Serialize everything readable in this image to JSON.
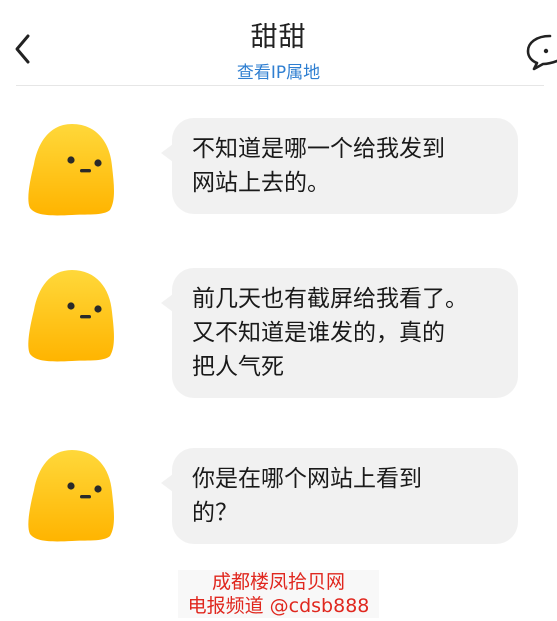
{
  "header": {
    "title": "甜甜",
    "subtitle": "查看IP属地",
    "back_icon": "chevron-left-icon",
    "right_icon": "chat-bubble-icon"
  },
  "messages": [
    {
      "sender": "甜甜",
      "text": "不知道是哪一个给我发到\n网站上去的。"
    },
    {
      "sender": "甜甜",
      "text": "前几天也有截屏给我看了。\n又不知道是谁发的，真的\n把人气死"
    },
    {
      "sender": "甜甜",
      "text": "你是在哪个网站上看到\n的？"
    }
  ],
  "watermark": {
    "line1": "成都楼凤拾贝网",
    "line2": "电报频道 @cdsb888"
  },
  "colors": {
    "accent_link": "#2f7fd1",
    "bubble_bg": "#f1f1f1",
    "avatar_yellow": "#ffc300",
    "watermark_red": "#e0271e"
  }
}
